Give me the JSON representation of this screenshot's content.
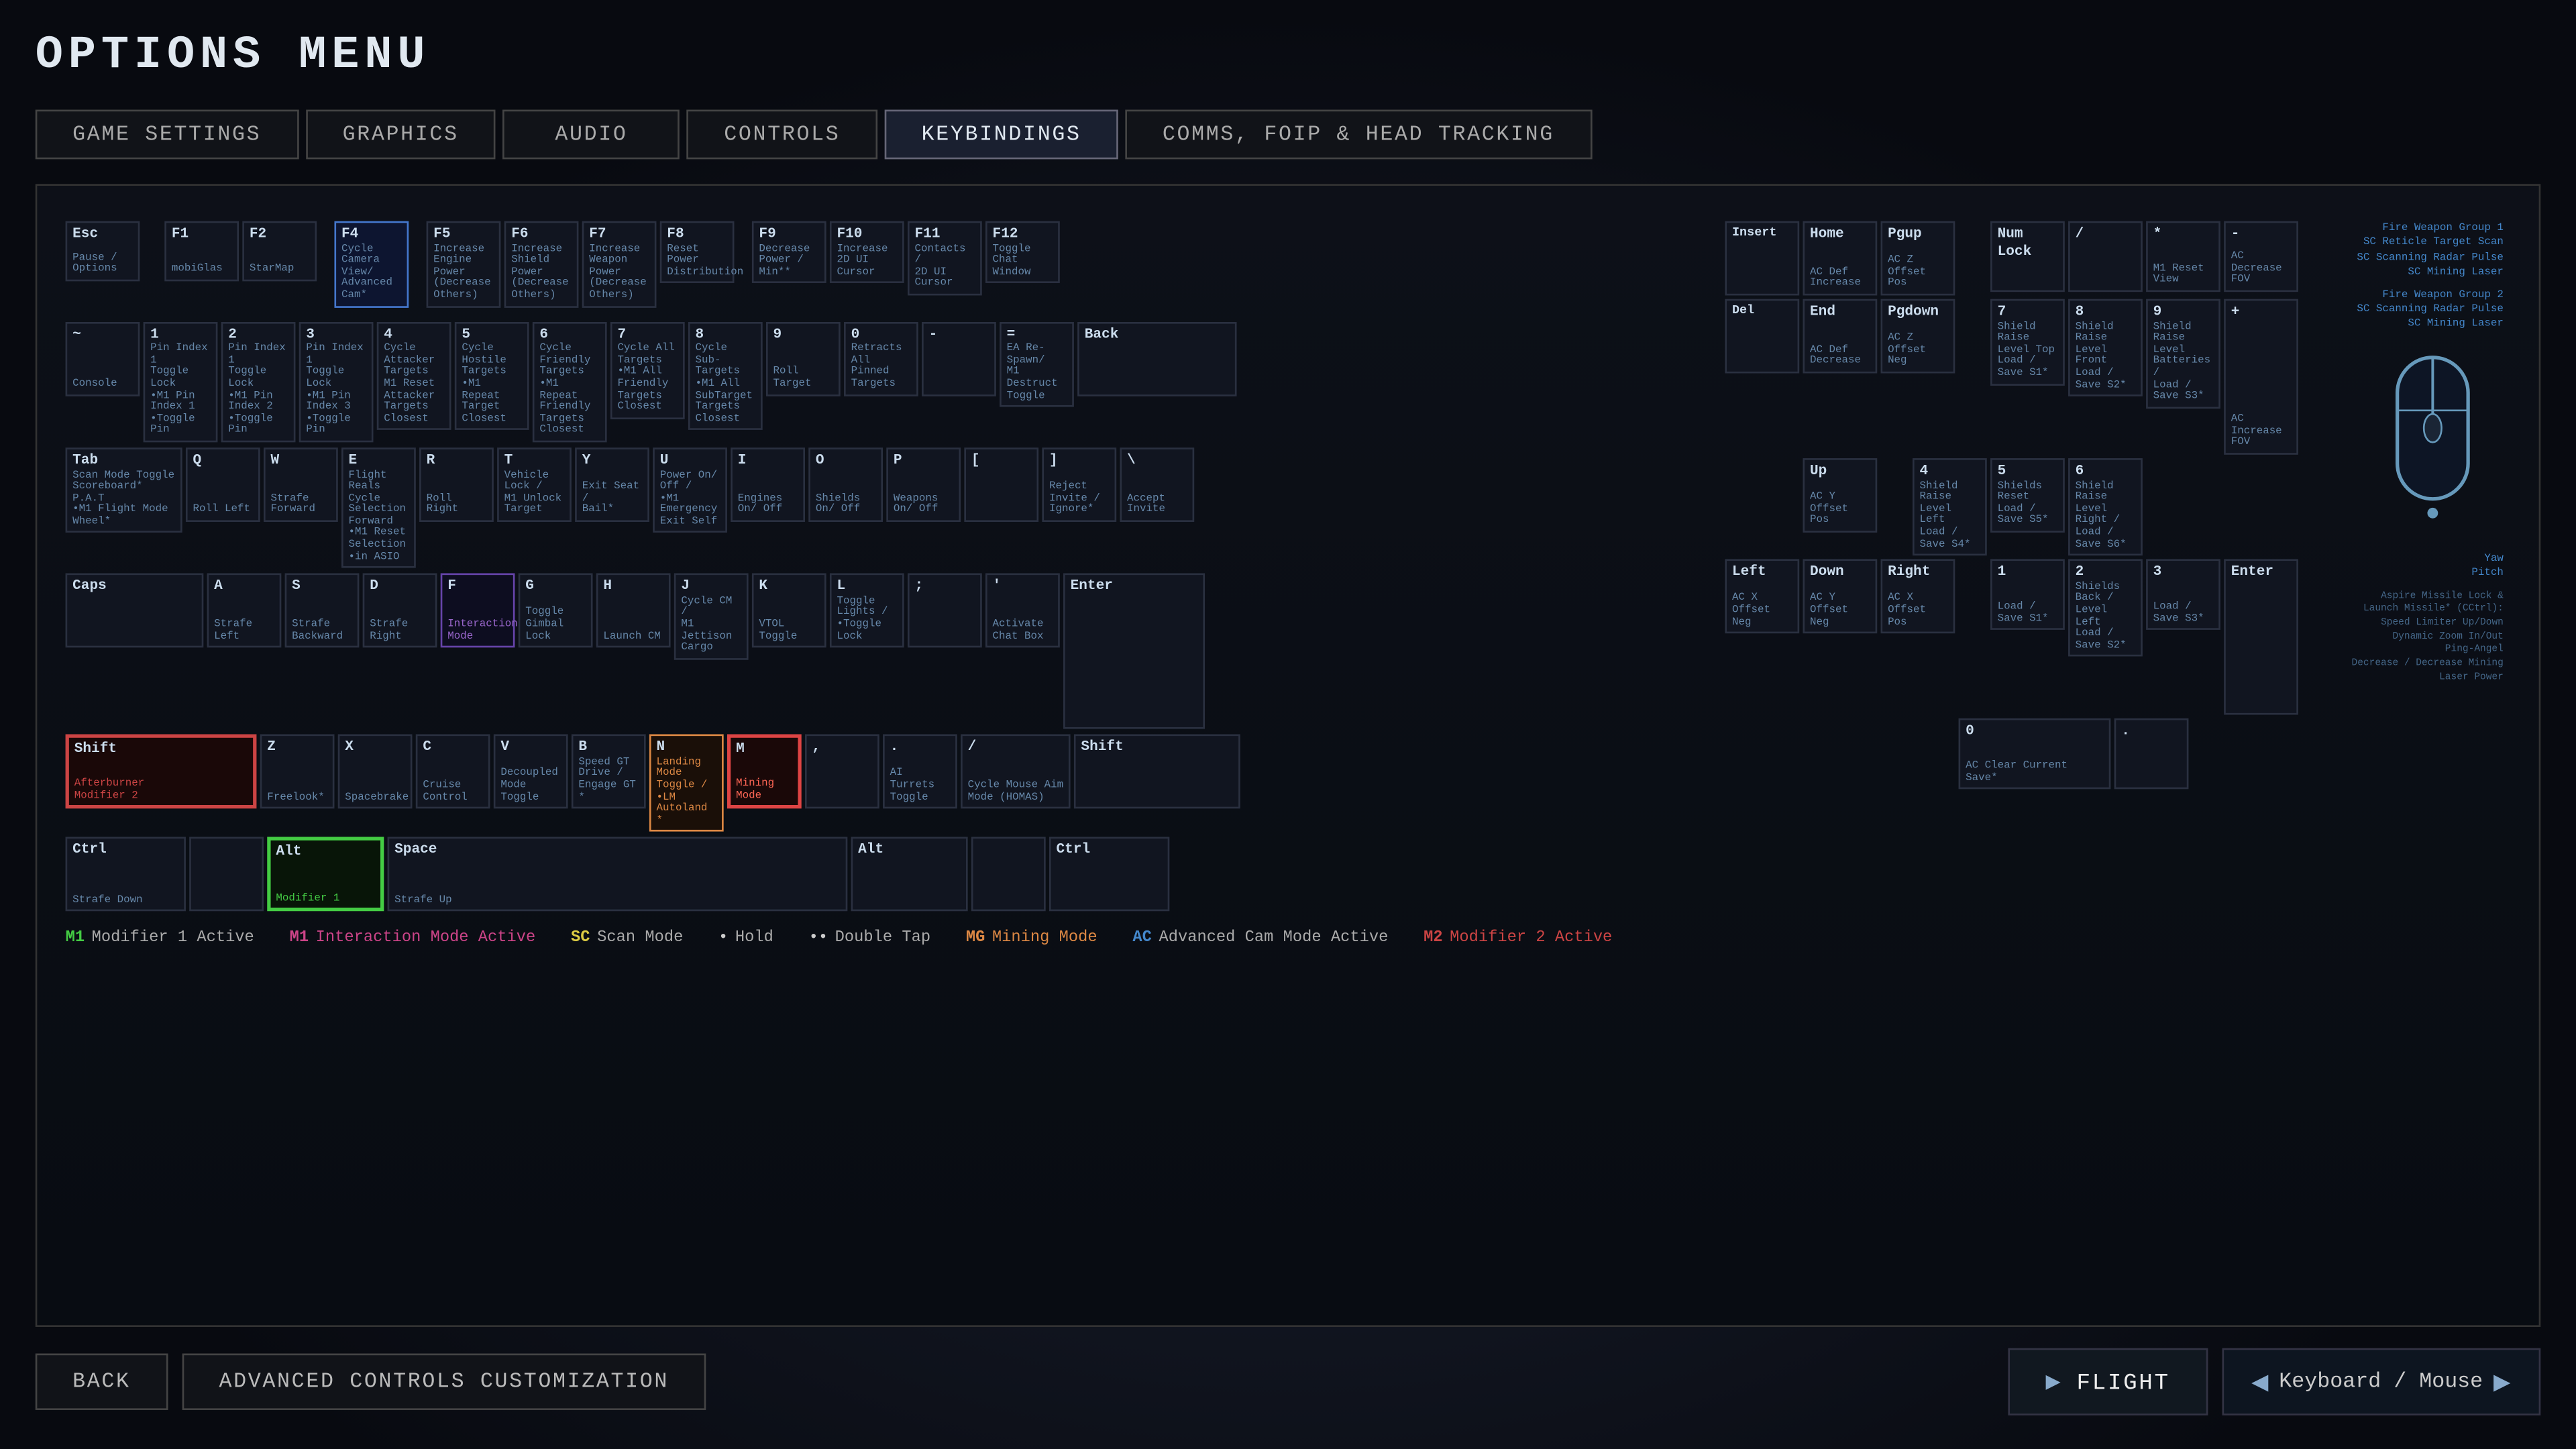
{
  "page": {
    "title": "OPTIONS MENU",
    "nav_tabs": [
      {
        "id": "game-settings",
        "label": "GAME SETTINGS",
        "active": false
      },
      {
        "id": "graphics",
        "label": "GRAPHICS",
        "active": false
      },
      {
        "id": "audio",
        "label": "AUDIO",
        "active": false
      },
      {
        "id": "controls",
        "label": "CONTROLS",
        "active": false
      },
      {
        "id": "keybindings",
        "label": "KEYBINDINGS",
        "active": true
      },
      {
        "id": "comms",
        "label": "COMMS, FOIP & HEAD TRACKING",
        "active": false
      }
    ]
  },
  "bottom": {
    "back_label": "BACK",
    "advanced_label": "ADVANCED CONTROLS CUSTOMIZATION",
    "flight_label": "FLIGHT",
    "input_method_label": "Keyboard / Mouse"
  },
  "legend": {
    "m1_key": "M1",
    "m1_label": "Modifier 1 Active",
    "m1i_key": "M1",
    "m1i_label": "Interaction Mode Active",
    "sc_key": "SC",
    "sc_label": "Scan Mode",
    "mg_key": "MG",
    "mg_label": "Mining Mode",
    "ac_key": "AC",
    "ac_label": "Advanced Cam Mode Active",
    "dot1_label": "Hold",
    "dot2_label": "Double Tap",
    "m2_key": "M2",
    "m2_label": "Modifier 2 Active"
  }
}
